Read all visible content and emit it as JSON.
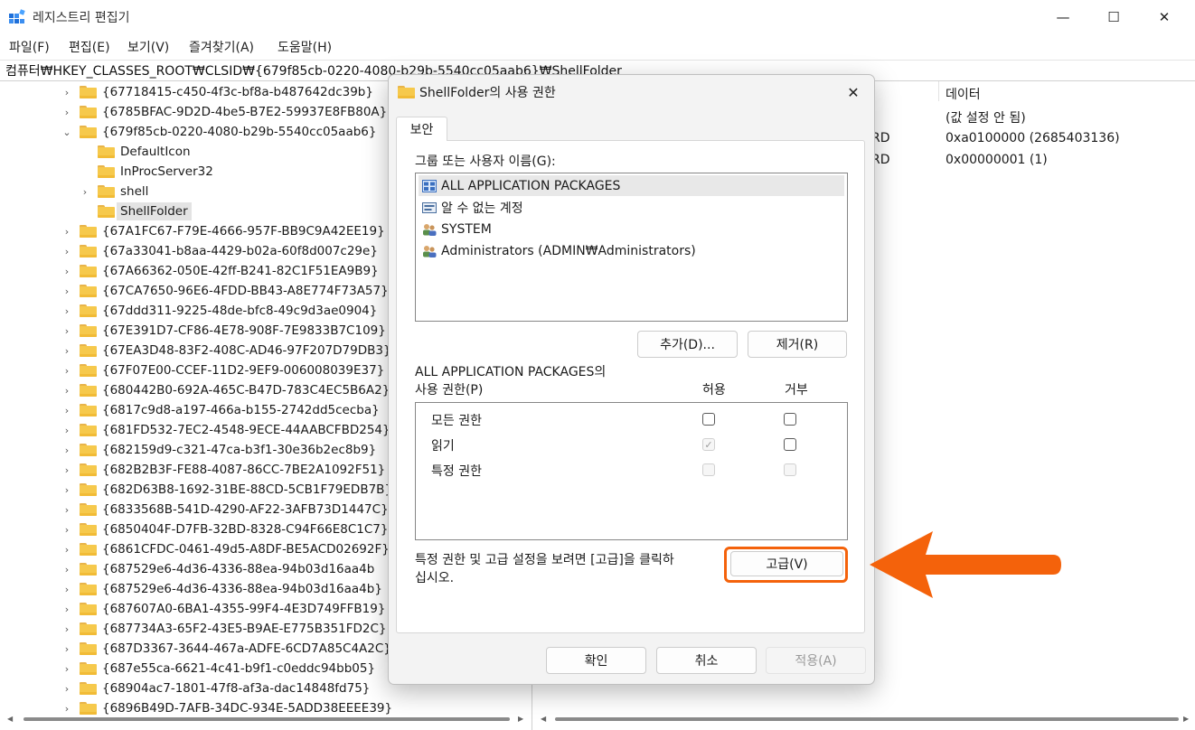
{
  "window": {
    "title": "레지스트리 편집기",
    "minimize": "—",
    "maximize": "☐",
    "close": "✕"
  },
  "menu": [
    "파일(F)",
    "편집(E)",
    "보기(V)",
    "즐겨찾기(A)",
    "도움말(H)"
  ],
  "address": "컴퓨터₩HKEY_CLASSES_ROOT₩CLSID₩{679f85cb-0220-4080-b29b-5540cc05aab6}₩ShellFolder",
  "tree": {
    "rows": [
      {
        "label": "{67718415-c450-4f3c-bf8a-b487642dc39b}",
        "chevron": "›"
      },
      {
        "label": "{6785BFAC-9D2D-4be5-B7E2-59937E8FB80A}",
        "chevron": "›"
      },
      {
        "label": "{679f85cb-0220-4080-b29b-5540cc05aab6}",
        "chevron": "⌄"
      },
      {
        "label": "DefaultIcon",
        "chevron": ""
      },
      {
        "label": "InProcServer32",
        "chevron": ""
      },
      {
        "label": "shell",
        "chevron": "›"
      },
      {
        "label": "ShellFolder",
        "chevron": ""
      },
      {
        "label": "{67A1FC67-F79E-4666-957F-BB9C9A42EE19}",
        "chevron": "›"
      },
      {
        "label": "{67a33041-b8aa-4429-b02a-60f8d007c29e}",
        "chevron": "›"
      },
      {
        "label": "{67A66362-050E-42ff-B241-82C1F51EA9B9}",
        "chevron": "›"
      },
      {
        "label": "{67CA7650-96E6-4FDD-BB43-A8E774F73A57}",
        "chevron": "›"
      },
      {
        "label": "{67ddd311-9225-48de-bfc8-49c9d3ae0904}",
        "chevron": "›"
      },
      {
        "label": "{67E391D7-CF86-4E78-908F-7E9833B7C109}",
        "chevron": "›"
      },
      {
        "label": "{67EA3D48-83F2-408C-AD46-97F207D79DB3}",
        "chevron": "›"
      },
      {
        "label": "{67F07E00-CCEF-11D2-9EF9-006008039E37}",
        "chevron": "›"
      },
      {
        "label": "{680442B0-692A-465C-B47D-783C4EC5B6A2}",
        "chevron": "›"
      },
      {
        "label": "{6817c9d8-a197-466a-b155-2742dd5cecba}",
        "chevron": "›"
      },
      {
        "label": "{681FD532-7EC2-4548-9ECE-44AABCFBD254}",
        "chevron": "›"
      },
      {
        "label": "{682159d9-c321-47ca-b3f1-30e36b2ec8b9}",
        "chevron": "›"
      },
      {
        "label": "{682B2B3F-FE88-4087-86CC-7BE2A1092F51}",
        "chevron": "›"
      },
      {
        "label": "{682D63B8-1692-31BE-88CD-5CB1F79EDB7B}",
        "chevron": "›"
      },
      {
        "label": "{6833568B-541D-4290-AF22-3AFB73D1447C}",
        "chevron": "›"
      },
      {
        "label": "{6850404F-D7FB-32BD-8328-C94F66E8C1C7}",
        "chevron": "›"
      },
      {
        "label": "{6861CFDC-0461-49d5-A8DF-BE5ACD02692F}",
        "chevron": "›"
      },
      {
        "label": "{687529e6-4d36-4336-88ea-94b03d16aa4b",
        "chevron": "›"
      },
      {
        "label": "{687529e6-4d36-4336-88ea-94b03d16aa4b}",
        "chevron": "›"
      },
      {
        "label": "{687607A0-6BA1-4355-99F4-4E3D749FFB19}",
        "chevron": "›"
      },
      {
        "label": "{687734A3-65F2-43E5-B9AE-E775B351FD2C}",
        "chevron": "›"
      },
      {
        "label": "{687D3367-3644-467a-ADFE-6CD7A85C4A2C}",
        "chevron": "›"
      },
      {
        "label": "{687e55ca-6621-4c41-b9f1-c0eddc94bb05}",
        "chevron": "›"
      },
      {
        "label": "{68904ac7-1801-47f8-af3a-dac14848fd75}",
        "chevron": "›"
      },
      {
        "label": "{6896B49D-7AFB-34DC-934E-5ADD38EEEE39}",
        "chevron": "›"
      }
    ]
  },
  "values": {
    "data_header": "데이터",
    "rows": [
      {
        "type_tail": "",
        "data": "(값 설정 안 됨)"
      },
      {
        "type_tail": "RD",
        "data": "0xa0100000 (2685403136)"
      },
      {
        "type_tail": "RD",
        "data": "0x00000001 (1)"
      }
    ]
  },
  "dialog": {
    "title": "ShellFolder의 사용 권한",
    "close": "✕",
    "tab": "보안",
    "group_label": "그룹 또는 사용자 이름(G):",
    "users": [
      {
        "name": "ALL APPLICATION PACKAGES",
        "icon": "package-icon"
      },
      {
        "name": "알 수 없는 계정",
        "icon": "unknown-account-icon"
      },
      {
        "name": "SYSTEM",
        "icon": "users-icon"
      },
      {
        "name": "Administrators (ADMIN₩Administrators)",
        "icon": "users-icon"
      }
    ],
    "add_button": "추가(D)...",
    "remove_button": "제거(R)",
    "perm_label_line1": "ALL APPLICATION PACKAGES의",
    "perm_label_line2": "사용 권한(P)",
    "allow_header": "허용",
    "deny_header": "거부",
    "permissions": [
      {
        "name": "모든 권한",
        "allow": false,
        "deny": false,
        "allow_disabled": false,
        "deny_disabled": false
      },
      {
        "name": "읽기",
        "allow": true,
        "deny": false,
        "allow_disabled": true,
        "deny_disabled": false
      },
      {
        "name": "특정 권한",
        "allow": false,
        "deny": false,
        "allow_disabled": true,
        "deny_disabled": true
      }
    ],
    "hint_line1": "특정 권한 및 고급 설정을 보려면 [고급]을 클릭하",
    "hint_line2": "십시오.",
    "advanced_button": "고급(V)",
    "ok_button": "확인",
    "cancel_button": "취소",
    "apply_button": "적용(A)"
  },
  "annotation_color": "#f4620b"
}
